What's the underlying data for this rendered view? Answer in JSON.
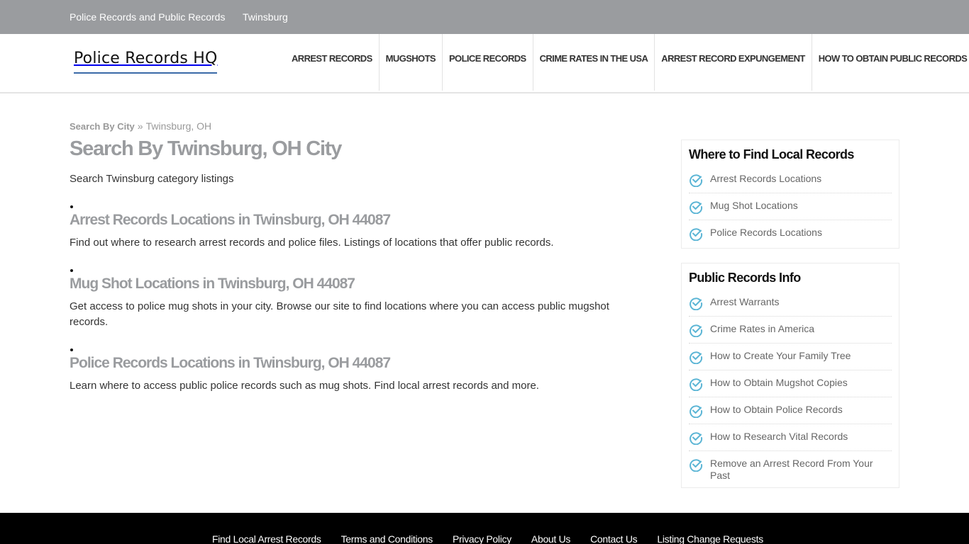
{
  "topbar": {
    "links": [
      "Police Records and Public Records",
      "Twinsburg"
    ]
  },
  "header": {
    "logo_text": "Police Records HQ",
    "logo_underline_color": "#3a6aa8",
    "nav": [
      "ARREST RECORDS",
      "MUGSHOTS",
      "POLICE RECORDS",
      "CRIME RATES IN THE USA",
      "ARREST RECORD EXPUNGEMENT",
      "HOW TO OBTAIN PUBLIC RECORDS"
    ]
  },
  "breadcrumb": {
    "parent": "Search By City",
    "separator": "»",
    "current": "Twinsburg, OH"
  },
  "main": {
    "title": "Search By Twinsburg, OH City",
    "intro": "Search Twinsburg category listings",
    "listings": [
      {
        "title": "Arrest Records Locations in Twinsburg, OH 44087",
        "description": "Find out where to research arrest records and police files. Listings of locations that offer public records."
      },
      {
        "title": "Mug Shot Locations in Twinsburg, OH 44087",
        "description": "Get access to police mug shots in your city. Browse our site to find locations where you can access public mugshot records."
      },
      {
        "title": "Police Records Locations in Twinsburg, OH 44087",
        "description": "Learn where to access public police records such as mug shots. Find local arrest records and more."
      }
    ]
  },
  "sidebar": {
    "check_icon_color": "#5bb5d5",
    "widgets": [
      {
        "title": "Where to Find Local Records",
        "items": [
          "Arrest Records Locations",
          "Mug Shot Locations",
          "Police Records Locations"
        ]
      },
      {
        "title": "Public Records Info",
        "items": [
          "Arrest Warrants",
          "Crime Rates in America",
          "How to Create Your Family Tree",
          "How to Obtain Mugshot Copies",
          "How to Obtain Police Records",
          "How to Research Vital Records",
          "Remove an Arrest Record From Your Past"
        ]
      }
    ]
  },
  "footer": {
    "links": [
      "Find Local Arrest Records",
      "Terms and Conditions",
      "Privacy Policy",
      "About Us",
      "Contact Us",
      "Listing Change Requests"
    ]
  }
}
